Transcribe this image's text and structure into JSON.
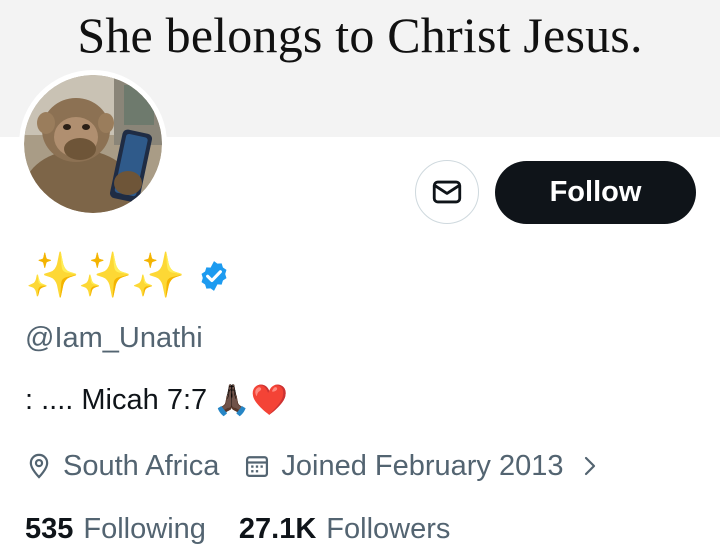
{
  "banner": {
    "text": "She belongs to Christ Jesus."
  },
  "profile": {
    "display_name": "✨✨✨",
    "verified": true,
    "handle": "@Iam_Unathi",
    "bio_text": ": .... Micah 7:7",
    "bio_emoji": "🙏🏿❤️",
    "location": "South Africa",
    "joined": "Joined February 2013"
  },
  "actions": {
    "follow_label": "Follow",
    "message_icon": "envelope-icon"
  },
  "stats": {
    "following_count": "535",
    "following_label": "Following",
    "followers_count": "27.1K",
    "followers_label": "Followers"
  },
  "colors": {
    "accent_dark": "#0f1419",
    "secondary_text": "#536471",
    "verified_blue": "#1d9bf0",
    "banner_bg": "#f3f3f3"
  }
}
